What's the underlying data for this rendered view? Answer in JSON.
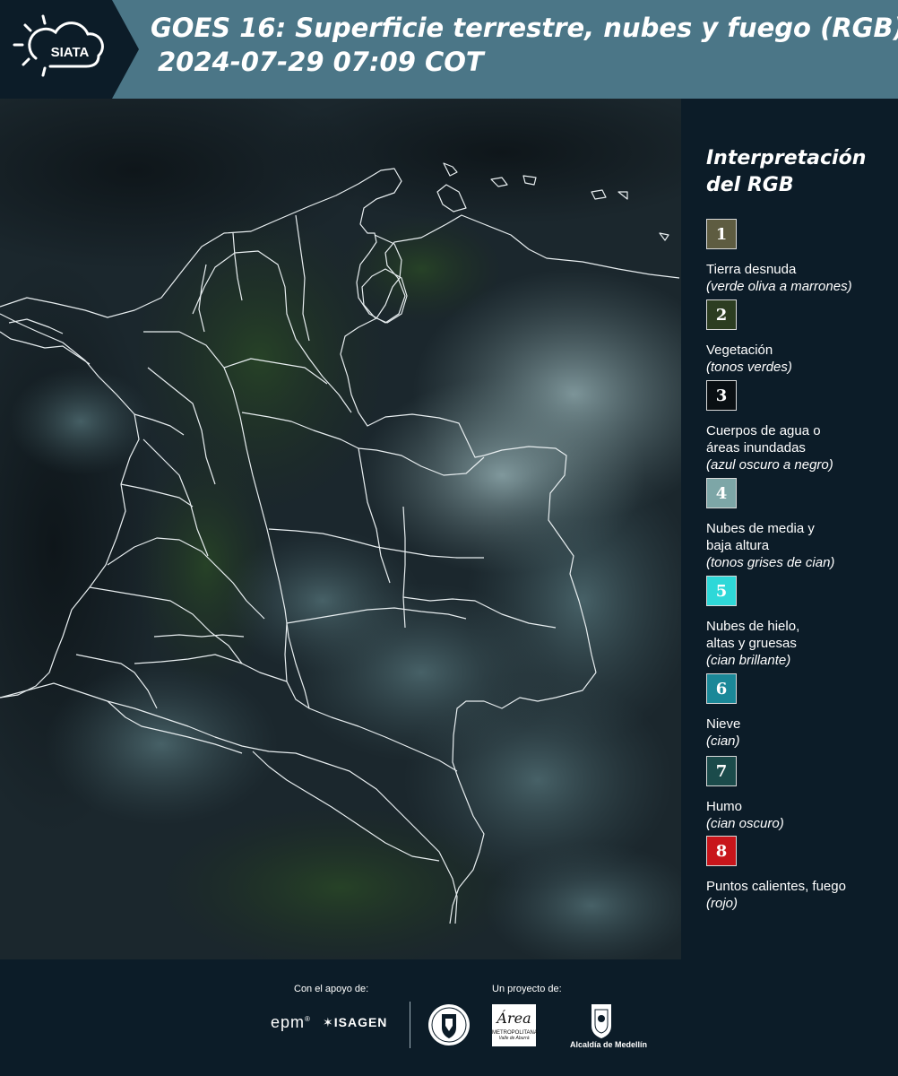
{
  "header": {
    "logo_text": "SIATA",
    "title_line1": "GOES 16: Superficie terrestre, nubes y fuego (RGB)",
    "title_line2": "2024-07-29 07:09 COT"
  },
  "legend": {
    "title_line1": "Interpretación",
    "title_line2": "del RGB",
    "items": [
      {
        "num": "1",
        "color": "#5e5c41",
        "label1": "Tierra desnuda",
        "label2": "",
        "sub": "(verde oliva a marrones)"
      },
      {
        "num": "2",
        "color": "#2c3d21",
        "label1": "Vegetación",
        "label2": "",
        "sub": "(tonos verdes)"
      },
      {
        "num": "3",
        "color": "#0a0f13",
        "label1": "Cuerpos de agua o",
        "label2": "áreas inundadas",
        "sub": "(azul oscuro a negro)"
      },
      {
        "num": "4",
        "color": "#7da6a7",
        "label1": "Nubes de media y",
        "label2": "baja altura",
        "sub": "(tonos grises de cian)"
      },
      {
        "num": "5",
        "color": "#2ed8d8",
        "label1": "Nubes de hielo,",
        "label2": "altas y gruesas",
        "sub": "(cian brillante)"
      },
      {
        "num": "6",
        "color": "#1b8898",
        "label1": "Nieve",
        "label2": "",
        "sub": "(cian)"
      },
      {
        "num": "7",
        "color": "#1b4b4b",
        "label1": "Humo",
        "label2": "",
        "sub": "(cian oscuro)"
      },
      {
        "num": "8",
        "color": "#c8151b",
        "label1": "Puntos calientes, fuego",
        "label2": "",
        "sub": "(rojo)"
      }
    ]
  },
  "footer": {
    "support_label": "Con el apoyo de:",
    "project_label": "Un proyecto de:",
    "sponsor1": "epm",
    "sponsor2": "ISAGEN",
    "partner_area": "Área",
    "partner_area_sub1": "METROPOLITANA",
    "partner_area_sub2": "Valle de Aburrá",
    "partner_alcaldia": "Alcaldía de Medellín"
  }
}
